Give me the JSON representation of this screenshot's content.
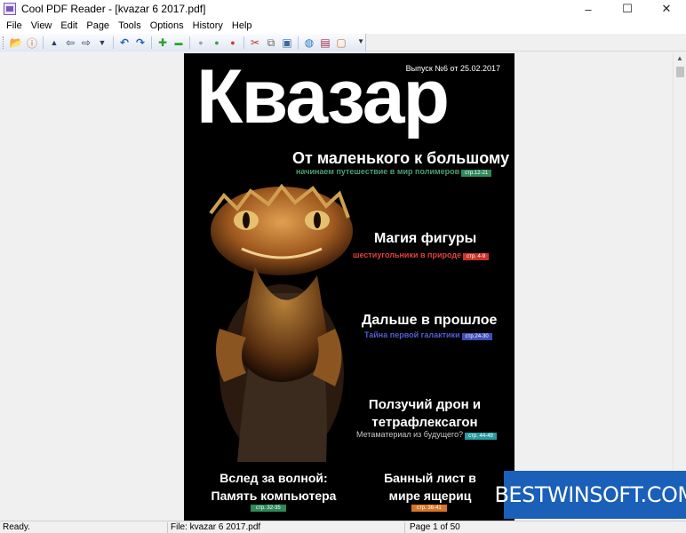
{
  "window": {
    "title": "Cool PDF Reader - [kvazar 6 2017.pdf]",
    "controls": {
      "minimize": "–",
      "maximize": "☐",
      "close": "✕"
    }
  },
  "menu": {
    "items": [
      {
        "label": "File"
      },
      {
        "label": "View"
      },
      {
        "label": "Edit"
      },
      {
        "label": "Page"
      },
      {
        "label": "Tools"
      },
      {
        "label": "Options"
      },
      {
        "label": "History"
      },
      {
        "label": "Help"
      }
    ]
  },
  "toolbar": {
    "buttons": [
      {
        "name": "open-icon",
        "glyph": "📂"
      },
      {
        "name": "info-icon",
        "glyph": "ⓘ"
      },
      {
        "name": "first-page-icon",
        "glyph": "▲"
      },
      {
        "name": "back-icon",
        "glyph": "⇦"
      },
      {
        "name": "forward-icon",
        "glyph": "⇨"
      },
      {
        "name": "last-page-icon",
        "glyph": "▼"
      },
      {
        "name": "rotate-left-icon",
        "glyph": "↶"
      },
      {
        "name": "rotate-right-icon",
        "glyph": "↷"
      },
      {
        "name": "zoom-in-icon",
        "glyph": "✚"
      },
      {
        "name": "zoom-out-icon",
        "glyph": "▬"
      },
      {
        "name": "fit-page-icon",
        "glyph": "●"
      },
      {
        "name": "fit-width-icon",
        "glyph": "●"
      },
      {
        "name": "actual-size-icon",
        "glyph": "●"
      },
      {
        "name": "convert-icon",
        "glyph": "✂"
      },
      {
        "name": "copy-icon",
        "glyph": "⧉"
      },
      {
        "name": "image-icon",
        "glyph": "▣"
      },
      {
        "name": "globe-icon",
        "glyph": "◍"
      },
      {
        "name": "books-icon",
        "glyph": "▤"
      },
      {
        "name": "exit-icon",
        "glyph": "▢"
      }
    ]
  },
  "document": {
    "issue": "Выпуск №6 от 25.02.2017",
    "masthead": "Квазар",
    "articles": [
      {
        "headline": "От маленького к большому",
        "subline": "начинаем путешествие в мир полимеров",
        "tag": "стр.12-21"
      },
      {
        "headline": "Магия фигуры",
        "subline": "шестиугольники в природе",
        "tag": "стр. 4-9"
      },
      {
        "headline": "Дальше в прошлое",
        "subline": "Тайна первой галактики",
        "tag": "стр.24-30"
      },
      {
        "headline": "Ползучий дрон и тетрафлексагон",
        "subline": "Метаматериал из будущего?",
        "tag": "стр. 44-49"
      },
      {
        "headline": "Вслед за волной: Память компьютера",
        "tag": "стр. 32-35"
      },
      {
        "headline": "Банный лист в мире ящериц",
        "tag": "стр. 36-41"
      }
    ]
  },
  "watermark": "BESTWINSOFT.COM",
  "status": {
    "state": "Ready.",
    "file": "File: kvazar 6 2017.pdf",
    "page": "Page 1 of 50"
  }
}
